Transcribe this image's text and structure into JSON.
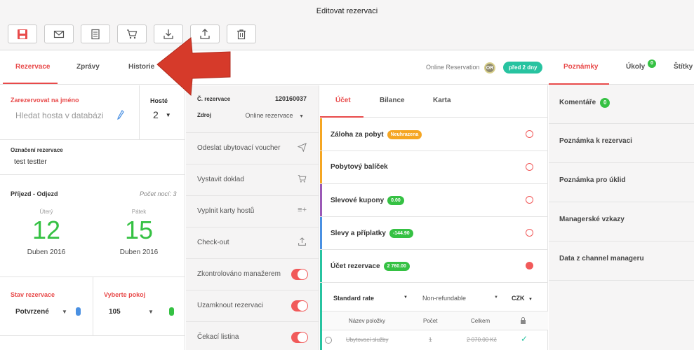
{
  "window": {
    "title": "Editovat rezervaci"
  },
  "toolbar": {
    "buttons": [
      {
        "icon": "save-icon",
        "color": "#e84a4a"
      },
      {
        "icon": "envelope-icon"
      },
      {
        "icon": "document-icon"
      },
      {
        "icon": "cart-icon"
      },
      {
        "icon": "download-icon"
      },
      {
        "icon": "upload-icon"
      },
      {
        "icon": "trash-icon"
      }
    ]
  },
  "tabs": {
    "rezervace": "Rezervace",
    "zpravy": "Zprávy",
    "historie": "Historie"
  },
  "header_right": {
    "online_label": "Online Reservation",
    "or_badge": "OR",
    "time_pill": "před 2 dny"
  },
  "booking": {
    "reserve_label": "Zarezervovat na jméno",
    "guest_search_placeholder": "Hledat hosta v databázi",
    "guests_label": "Hosté",
    "guests_value": "2",
    "marking_label": "Označení rezervace",
    "marking_value": "test testter",
    "arrival_departure_label": "Příjezd - Odjezd",
    "nights_label": "Počet nocí: 3",
    "arrival": {
      "weekday": "Úterý",
      "day": "12",
      "month": "Duben 2016"
    },
    "departure": {
      "weekday": "Pátek",
      "day": "15",
      "month": "Duben 2016"
    },
    "status_label": "Stav rezervace",
    "status_value": "Potvrzené",
    "room_label": "Vyberte pokoj",
    "room_value": "105"
  },
  "reservation_info": {
    "number_label": "Č. rezervace",
    "number_value": "120160037",
    "source_label": "Zdroj",
    "source_value": "Online rezervace"
  },
  "actions": [
    {
      "label": "Odeslat ubytovací voucher",
      "icon": "send-icon"
    },
    {
      "label": "Vystavit doklad",
      "icon": "cart-icon"
    },
    {
      "label": "Vyplnit karty hostů",
      "icon": "list-plus-icon"
    },
    {
      "label": "Check-out",
      "icon": "upload-icon"
    },
    {
      "label": "Zkontrolováno manažerem",
      "toggle": true
    },
    {
      "label": "Uzamknout rezervaci",
      "toggle": true
    },
    {
      "label": "Čekací listina",
      "toggle": true
    }
  ],
  "account_tabs": {
    "ucet": "Účet",
    "bilance": "Bilance",
    "karta": "Karta"
  },
  "account_items": [
    {
      "label": "Záloha za pobyt",
      "badge": "Neuhrazena",
      "badge_color": "#f5a623",
      "bar_color": "#f5a623"
    },
    {
      "label": "Pobytový balíček",
      "badge": "",
      "bar_color": "#f5a623"
    },
    {
      "label": "Slevové kupony",
      "badge": "0.00",
      "badge_color": "#35c143",
      "bar_color": "#9b59b6"
    },
    {
      "label": "Slevy a příplatky",
      "badge": "-144.90",
      "badge_color": "#35c143",
      "bar_color": "#4a90e2"
    },
    {
      "label": "Účet rezervace",
      "badge": "2 760.00",
      "badge_color": "#35c143",
      "bar_color": "#27c3a0",
      "filled": true
    }
  ],
  "rate_row": {
    "rate": "Standard rate",
    "refund": "Non-refundable",
    "currency": "CZK"
  },
  "items_table": {
    "headers": [
      "Název položky",
      "Počet",
      "Celkem"
    ],
    "row": {
      "name": "Ubytovací služby",
      "count": "1",
      "total": "2 070.00 Kč"
    }
  },
  "right_panel": {
    "tabs": {
      "poznamky": "Poznámky",
      "ukoly": "Úkoly",
      "ukoly_count": "0",
      "stitky": "Štítky"
    },
    "comments_label": "Komentáře",
    "comments_count": "0",
    "items": [
      "Poznámka k rezervaci",
      "Poznámka pro úklid",
      "Managerské vzkazy",
      "Data z channel manageru"
    ]
  }
}
